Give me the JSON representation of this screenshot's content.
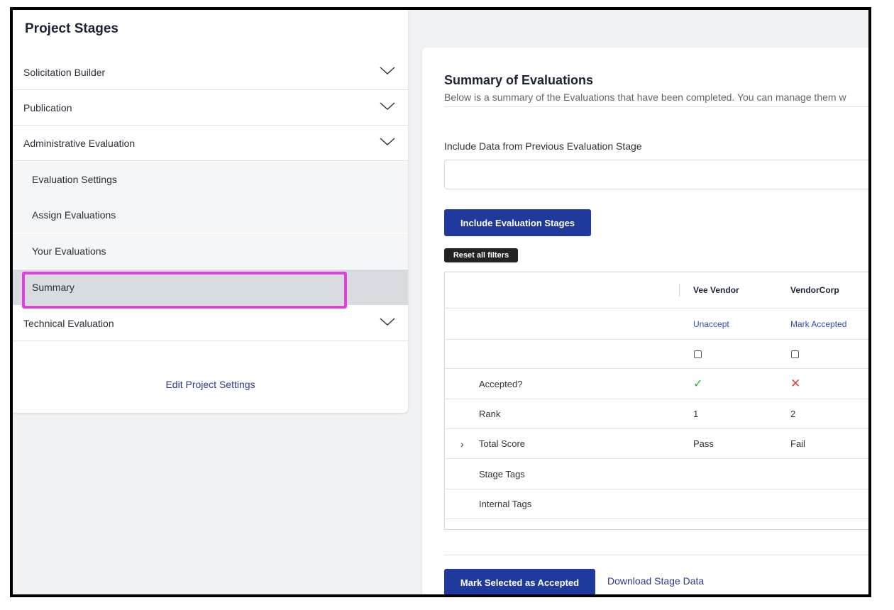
{
  "sidebar": {
    "title": "Project Stages",
    "items": [
      {
        "label": "Solicitation Builder"
      },
      {
        "label": "Publication"
      },
      {
        "label": "Administrative Evaluation"
      },
      {
        "label": "Technical Evaluation"
      }
    ],
    "subitems": [
      {
        "label": "Evaluation Settings"
      },
      {
        "label": "Assign Evaluations"
      },
      {
        "label": "Your Evaluations"
      },
      {
        "label": "Summary",
        "active": true
      }
    ],
    "edit_link": "Edit Project Settings"
  },
  "main": {
    "title": "Summary of Evaluations",
    "description": "Below is a summary of the Evaluations that have been completed. You can manage them w",
    "include_label": "Include Data from Previous Evaluation Stage",
    "include_input_value": "",
    "include_button": "Include Evaluation Stages",
    "reset_filters": "Reset all filters",
    "table": {
      "columns": [
        "Vee Vendor",
        "VendorCorp"
      ],
      "actions": [
        "Unaccept",
        "Mark Accepted"
      ],
      "rows": [
        {
          "label": "Accepted?",
          "values": [
            "check",
            "cross"
          ]
        },
        {
          "label": "Rank",
          "values": [
            "1",
            "2"
          ]
        },
        {
          "label": "Total Score",
          "values": [
            "Pass",
            "Fail"
          ],
          "expandable": true
        },
        {
          "label": "Stage Tags",
          "values": [
            "",
            ""
          ]
        },
        {
          "label": "Internal Tags",
          "values": [
            "",
            ""
          ]
        }
      ]
    },
    "mark_button": "Mark Selected as Accepted",
    "download_link": "Download Stage Data"
  },
  "colors": {
    "primary": "#1f3a9c",
    "highlight": "#e23ee3",
    "accept": "#3aaa4a",
    "reject": "#e0453c"
  }
}
